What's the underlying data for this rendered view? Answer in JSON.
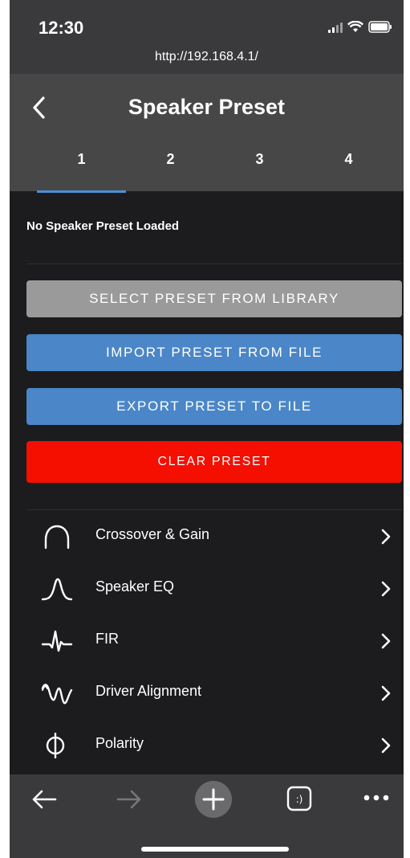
{
  "status_bar": {
    "time": "12:30",
    "url": "http://192.168.4.1/"
  },
  "header": {
    "title": "Speaker Preset",
    "tabs": [
      "1",
      "2",
      "3",
      "4"
    ],
    "active_tab": "1"
  },
  "preset": {
    "status": "No Speaker Preset Loaded",
    "buttons": {
      "select": "SELECT PRESET FROM LIBRARY",
      "import": "IMPORT PRESET FROM FILE",
      "export": "EXPORT PRESET TO FILE",
      "clear": "CLEAR PRESET"
    }
  },
  "menu": [
    {
      "label": "Crossover & Gain",
      "icon": "crossover-icon"
    },
    {
      "label": "Speaker EQ",
      "icon": "eq-bell-icon"
    },
    {
      "label": "FIR",
      "icon": "fir-impulse-icon"
    },
    {
      "label": "Driver Alignment",
      "icon": "alignment-wave-icon"
    },
    {
      "label": "Polarity",
      "icon": "polarity-phi-icon"
    }
  ],
  "colors": {
    "accent_blue": "#4a86c8",
    "danger_red": "#f40f00",
    "tab_indicator": "#4a90d9"
  }
}
